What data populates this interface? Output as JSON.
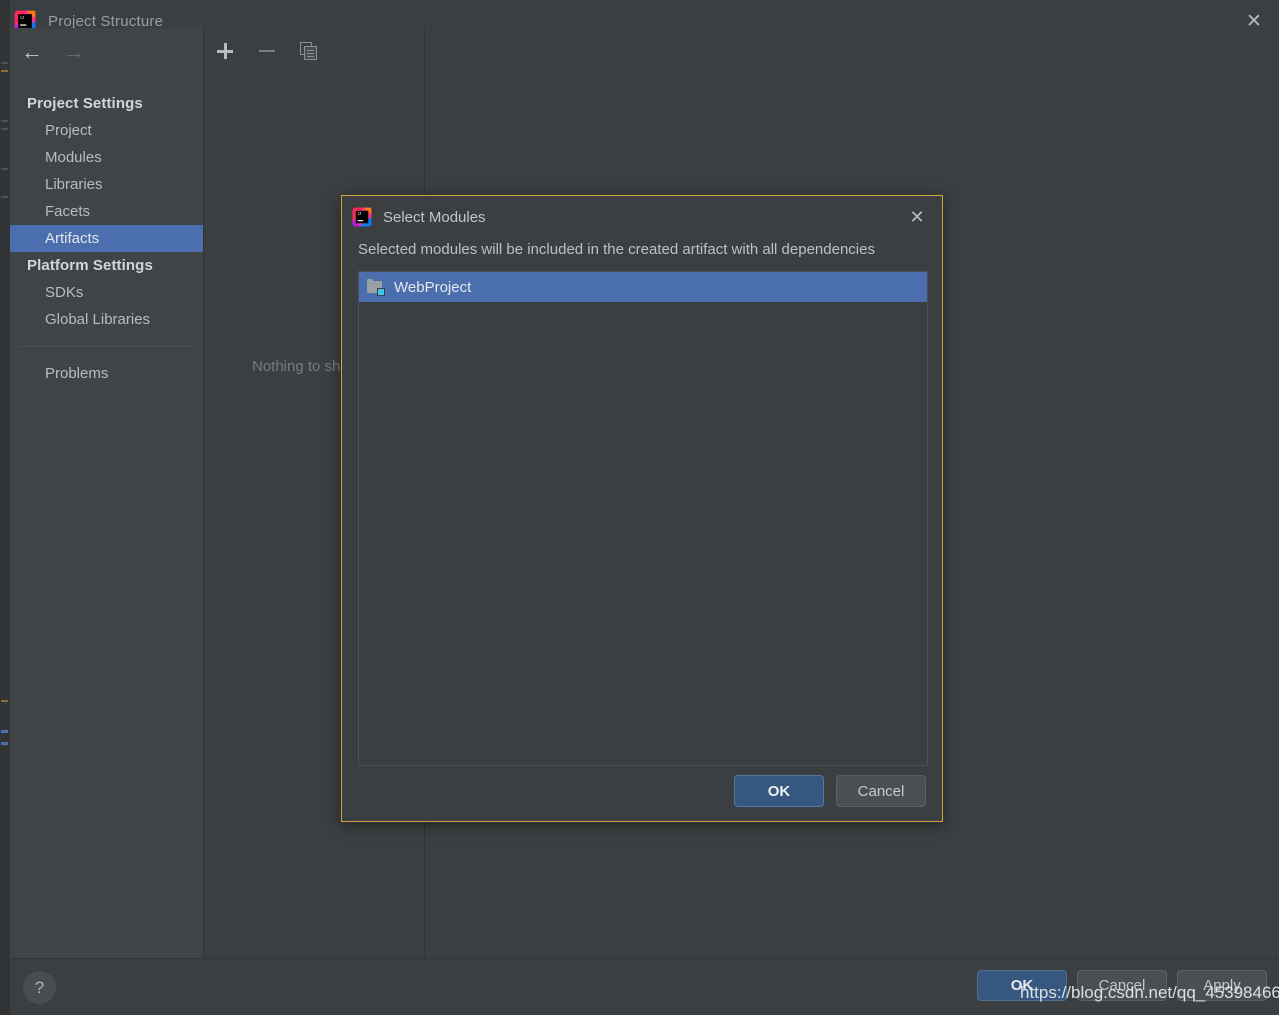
{
  "window": {
    "title": "Project Structure",
    "logo_icon": "intellij-idea-logo",
    "close_icon": "close-icon"
  },
  "nav": {
    "back_icon": "arrow-left-icon",
    "forward_icon": "arrow-right-icon",
    "groups": [
      {
        "label": "Project Settings",
        "items": [
          {
            "label": "Project",
            "selected": false
          },
          {
            "label": "Modules",
            "selected": false
          },
          {
            "label": "Libraries",
            "selected": false
          },
          {
            "label": "Facets",
            "selected": false
          },
          {
            "label": "Artifacts",
            "selected": true
          }
        ]
      },
      {
        "label": "Platform Settings",
        "items": [
          {
            "label": "SDKs",
            "selected": false
          },
          {
            "label": "Global Libraries",
            "selected": false
          }
        ]
      }
    ],
    "extra_items": [
      {
        "label": "Problems",
        "selected": false
      }
    ]
  },
  "toolbar": {
    "add_icon": "plus-icon",
    "remove_icon": "minus-icon",
    "copy_icon": "copy-icon"
  },
  "content": {
    "empty_text": "Nothing to show"
  },
  "bottom_bar": {
    "help_label": "?",
    "buttons": [
      {
        "label": "OK",
        "primary": true
      },
      {
        "label": "Cancel",
        "primary": false
      },
      {
        "label": "Apply",
        "primary": false
      }
    ]
  },
  "dialog": {
    "logo_icon": "intellij-idea-logo",
    "title": "Select Modules",
    "close_icon": "close-icon",
    "description": "Selected modules will be included in the created artifact with all dependencies",
    "modules": [
      {
        "name": "WebProject",
        "icon": "module-folder-icon",
        "selected": true
      }
    ],
    "buttons": [
      {
        "label": "OK",
        "primary": true
      },
      {
        "label": "Cancel",
        "primary": false
      }
    ]
  },
  "watermark": {
    "text": "https://blog.csdn.net/qq_45398466"
  },
  "colors": {
    "accent_selection": "#4b6eaf",
    "primary_button": "#365880",
    "dialog_border": "#d2a240",
    "panel_bg": "#3c3f41",
    "nav_bg": "#414447"
  }
}
